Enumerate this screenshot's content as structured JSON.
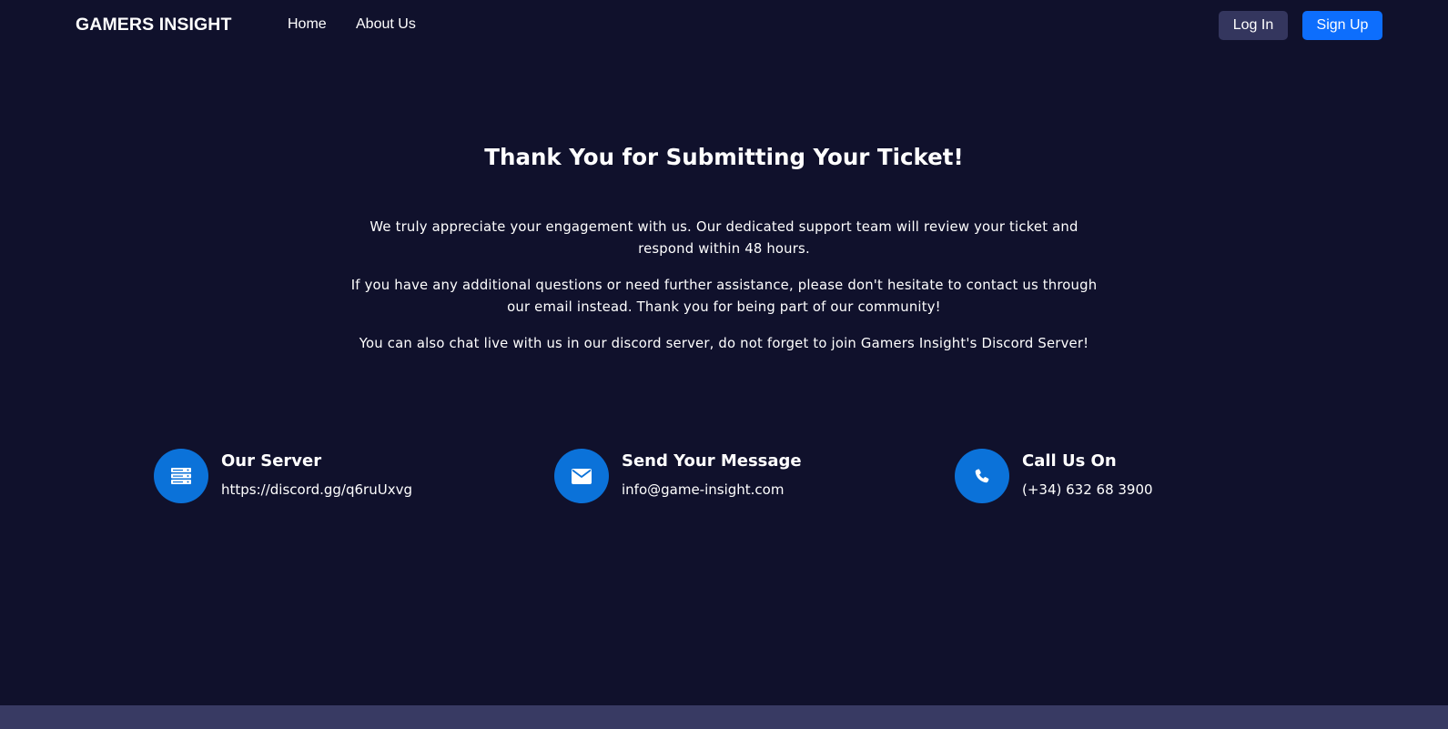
{
  "navbar": {
    "brand": "GAMERS INSIGHT",
    "links": [
      {
        "label": "Home"
      },
      {
        "label": "About Us"
      }
    ],
    "login_label": "Log In",
    "signup_label": "Sign Up"
  },
  "main": {
    "title": "Thank You for Submitting Your Ticket!",
    "paragraphs": [
      "We truly appreciate your engagement with us. Our dedicated support team will review your ticket and respond within 48 hours.",
      "If you have any additional questions or need further assistance, please don't hesitate to contact us through our email instead. Thank you for being part of our community!",
      "You can also chat live with us in our discord server, do not forget to join Gamers Insight's Discord Server!"
    ]
  },
  "contacts": [
    {
      "title": "Our Server",
      "value": "https://discord.gg/q6ruUxvg",
      "icon": "server-icon"
    },
    {
      "title": "Send Your Message",
      "value": "info@game-insight.com",
      "icon": "envelope-icon"
    },
    {
      "title": "Call Us On",
      "value": "(+34) 632 68 3900",
      "icon": "phone-icon"
    }
  ],
  "colors": {
    "background": "#10112c",
    "icon_circle": "#0b72d9",
    "login_button": "#34365e",
    "signup_button": "#0d6efd",
    "footer_bar": "#383a63"
  }
}
